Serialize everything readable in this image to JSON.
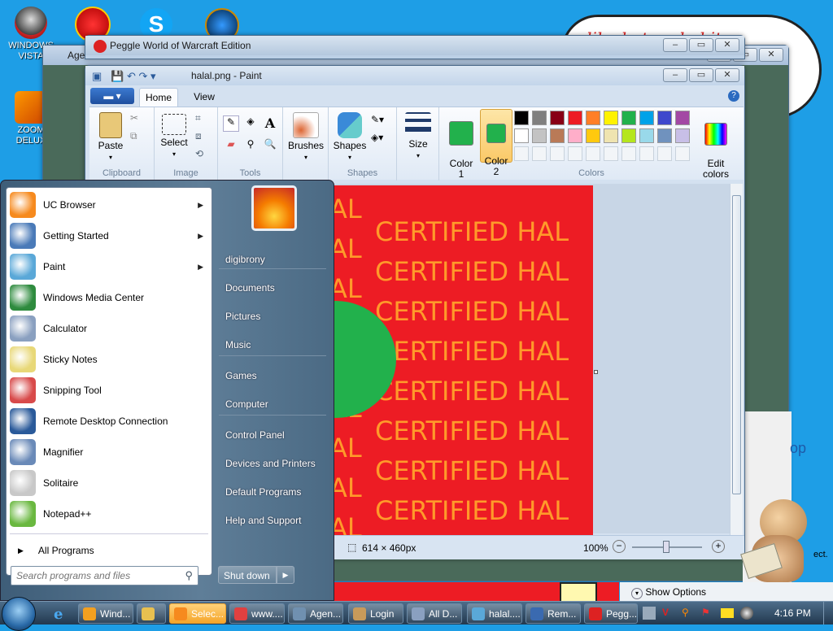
{
  "desktop": {
    "icons": [
      {
        "label": "WINDOWS VISTA",
        "icon": "vista-ball-icon"
      },
      {
        "label": "ZOOM DELUX",
        "icon": "zoom-game-icon"
      }
    ],
    "cloud_text": "lil what up habit"
  },
  "peggle": {
    "title": "Peggle World of Warcraft Edition"
  },
  "behind": {
    "title": "Agen"
  },
  "paint": {
    "title": "halal.png - Paint",
    "tabs": {
      "home": "Home",
      "view": "View"
    },
    "groups": {
      "clipboard": "Clipboard",
      "image": "Image",
      "tools": "Tools",
      "shapes": "Shapes",
      "colors": "Colors"
    },
    "buttons": {
      "paste": "Paste",
      "select": "Select",
      "brushes": "Brushes",
      "shapes": "Shapes",
      "size": "Size",
      "color1": "Color\n1",
      "color2": "Color\n2",
      "edit_colors": "Edit\ncolors"
    },
    "canvas_text": "CERTIFIED HAL",
    "canvas_text_left": "AL",
    "status": {
      "size": "614 × 460px",
      "zoom": "100%"
    },
    "palette": [
      "#000000",
      "#7f7f7f",
      "#880015",
      "#ed1c24",
      "#ff7f27",
      "#fff200",
      "#22b14c",
      "#00a2e8",
      "#3f48cc",
      "#a349a4",
      "#ffffff",
      "#c3c3c3",
      "#b97a57",
      "#ffaec9",
      "#ffc90e",
      "#efe4b0",
      "#b5e61d",
      "#99d9ea",
      "#7092be",
      "#c8bfe7"
    ],
    "color1": "#22b14c",
    "color2": "#22b14c"
  },
  "start_menu": {
    "programs": [
      {
        "label": "UC Browser",
        "icon": "uc-browser-icon",
        "arrow": true
      },
      {
        "label": "Getting Started",
        "icon": "getting-started-icon",
        "arrow": true
      },
      {
        "label": "Paint",
        "icon": "paint-icon",
        "arrow": true
      },
      {
        "label": "Windows Media Center",
        "icon": "media-center-icon",
        "arrow": false
      },
      {
        "label": "Calculator",
        "icon": "calculator-icon",
        "arrow": false
      },
      {
        "label": "Sticky Notes",
        "icon": "sticky-notes-icon",
        "arrow": false
      },
      {
        "label": "Snipping Tool",
        "icon": "snipping-tool-icon",
        "arrow": false
      },
      {
        "label": "Remote Desktop Connection",
        "icon": "remote-desktop-icon",
        "arrow": false
      },
      {
        "label": "Magnifier",
        "icon": "magnifier-icon",
        "arrow": false
      },
      {
        "label": "Solitaire",
        "icon": "solitaire-icon",
        "arrow": false
      },
      {
        "label": "Notepad++",
        "icon": "notepadpp-icon",
        "arrow": false
      }
    ],
    "all_programs": "All Programs",
    "search_placeholder": "Search programs and files",
    "right": [
      "digibrony",
      "Documents",
      "Pictures",
      "Music",
      "Games",
      "Computer",
      "Control Panel",
      "Devices and Printers",
      "Default Programs",
      "Help and Support"
    ],
    "shutdown": "Shut down"
  },
  "bottom": {
    "show_options": "Show Options",
    "right_text_op": "op",
    "right_text_ect": "ect."
  },
  "taskbar": {
    "buttons": [
      "Wind...",
      "",
      "Selec...",
      "www....",
      "Agen...",
      "Login",
      "All D...",
      "halal....",
      "Rem...",
      "Pegg..."
    ],
    "clock": "4:16 PM"
  }
}
